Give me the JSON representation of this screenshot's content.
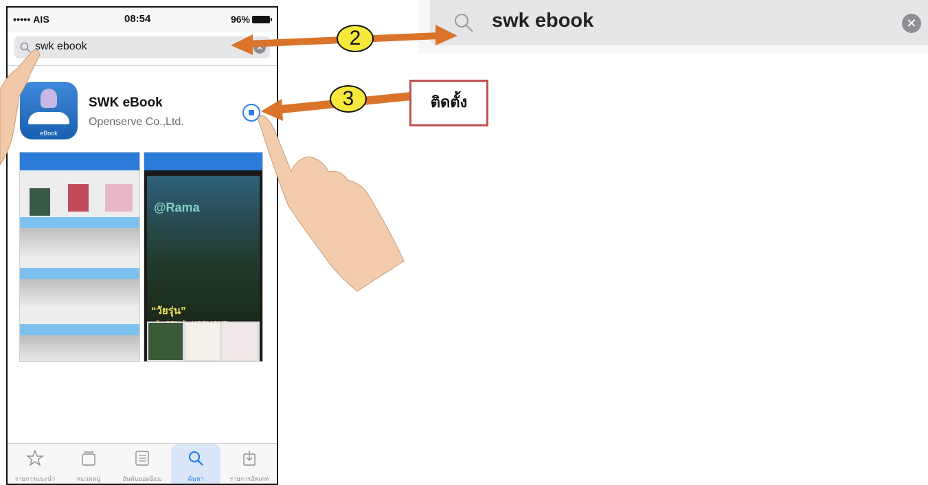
{
  "status_bar": {
    "carrier": "••••• AIS",
    "time": "08:54",
    "battery": "96%"
  },
  "search": {
    "query": "swk ebook"
  },
  "app": {
    "name": "SWK eBook",
    "developer": "Openserve Co.,Ltd.",
    "icon_label": "eBook"
  },
  "screenshot2": {
    "logo": "@Rama",
    "headline": "“วัยรุ่น”",
    "subline": "วัย GEN วัย HORMONE"
  },
  "tabs": [
    {
      "label": "รายการแนะนำ",
      "icon": "star-icon"
    },
    {
      "label": "หมวดหมู่",
      "icon": "categories-icon"
    },
    {
      "label": "อันดับยอดนิยม",
      "icon": "list-icon"
    },
    {
      "label": "ค้นหา",
      "icon": "search-icon",
      "active": true
    },
    {
      "label": "รายการอัพเดท",
      "icon": "updates-icon"
    }
  ],
  "zoom": {
    "query": "swk ebook"
  },
  "annotations": {
    "step2": "2",
    "step3": "3",
    "callout": "ติดตั้ง"
  },
  "colors": {
    "accent": "#2a7ee8",
    "arrow": "#d9742a",
    "badge": "#f7e93b",
    "callout_border": "#c0504d"
  }
}
